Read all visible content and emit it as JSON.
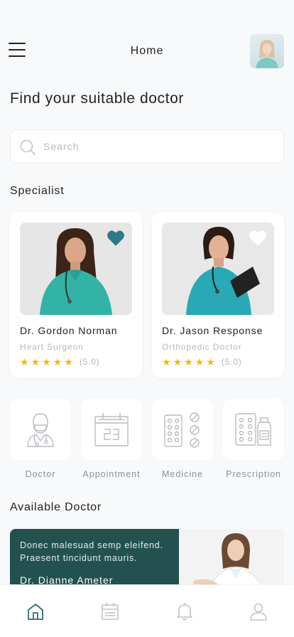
{
  "header": {
    "title": "Home",
    "avatar_icon": "user-avatar"
  },
  "headline": "Find your suitable doctor",
  "search": {
    "placeholder": "Search",
    "value": ""
  },
  "specialist": {
    "title": "Specialist",
    "doctors": [
      {
        "name": "Dr. Gordon Norman",
        "specialty": "Heart Surgeon",
        "rating_text": "(5.0)",
        "rating": 5,
        "favorite": true
      },
      {
        "name": "Dr. Jason Response",
        "specialty": "Orthopedic Doctor",
        "rating_text": "(5.0)",
        "rating": 5,
        "favorite": false
      }
    ]
  },
  "categories": [
    {
      "label": "Doctor",
      "icon": "doctor-icon"
    },
    {
      "label": "Appointment",
      "icon": "calendar-icon"
    },
    {
      "label": "Medicine",
      "icon": "pills-icon"
    },
    {
      "label": "Prescription",
      "icon": "prescription-icon"
    }
  ],
  "available": {
    "title": "Available Doctor",
    "card": {
      "text": "Donec malesuad semp eleifend. Praesent tincidunt mauris.",
      "name": "Dr. Dianne Ameter"
    }
  },
  "bottom_nav": [
    {
      "icon": "home-icon",
      "active": true
    },
    {
      "icon": "calendar-icon",
      "active": false
    },
    {
      "icon": "bell-icon",
      "active": false
    },
    {
      "icon": "profile-icon",
      "active": false
    }
  ],
  "colors": {
    "accent": "#2b7a8a",
    "star": "#f5b70a",
    "feature_bg": "#23514f",
    "nav_active": "#2b6e78",
    "nav_inactive": "#bfc3c7"
  }
}
